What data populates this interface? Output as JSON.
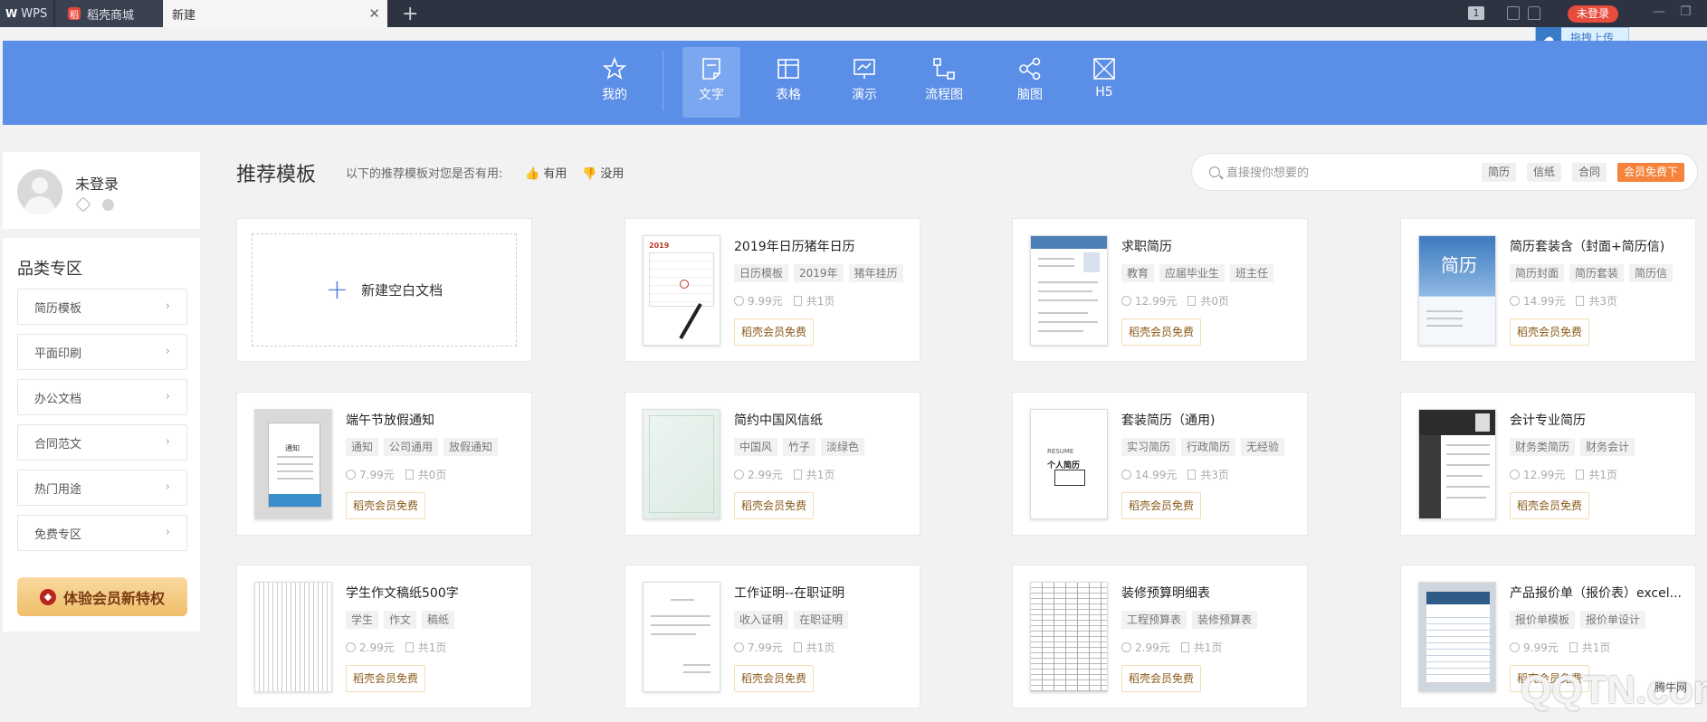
{
  "titlebar": {
    "tabs": [
      {
        "label": "WPS",
        "logo": "W"
      },
      {
        "label": "稻壳商城",
        "logo": "稻"
      },
      {
        "label": "新建"
      }
    ],
    "tab_count": "1",
    "login_label": "未登录",
    "upload_tip": "拖拽上传"
  },
  "categories": [
    {
      "label": "我的",
      "icon": "star-icon"
    },
    {
      "label": "文字",
      "icon": "document-icon"
    },
    {
      "label": "表格",
      "icon": "table-icon"
    },
    {
      "label": "演示",
      "icon": "presentation-icon"
    },
    {
      "label": "流程图",
      "icon": "flowchart-icon"
    },
    {
      "label": "脑图",
      "icon": "mindmap-icon"
    },
    {
      "label": "H5",
      "icon": "h5-icon"
    }
  ],
  "active_category": "文字",
  "user": {
    "name": "未登录"
  },
  "sidebar": {
    "title": "品类专区",
    "items": [
      {
        "label": "简历模板"
      },
      {
        "label": "平面印刷"
      },
      {
        "label": "办公文档"
      },
      {
        "label": "合同范文"
      },
      {
        "label": "热门用途"
      },
      {
        "label": "免费专区"
      }
    ],
    "vip_button": "体验会员新特权"
  },
  "main": {
    "title": "推荐模板",
    "feedback_prompt": "以下的推荐模板对您是否有用:",
    "useful": "有用",
    "useless": "没用"
  },
  "search": {
    "placeholder": "直接搜你想要的",
    "tags": [
      "简历",
      "信纸",
      "合同"
    ],
    "hot_tag": "会员免费下"
  },
  "new_blank_label": "新建空白文档",
  "templates": [
    {
      "title": "2019年日历猪年日历",
      "tags": [
        "日历模板",
        "2019年",
        "猪年挂历"
      ],
      "price": "9.99元",
      "pages": "共1页",
      "free": "稻壳会员免费"
    },
    {
      "title": "求职简历",
      "tags": [
        "教育",
        "应届毕业生",
        "班主任"
      ],
      "price": "12.99元",
      "pages": "共0页",
      "free": "稻壳会员免费"
    },
    {
      "title": "简历套装含（封面+简历信)",
      "tags": [
        "简历封面",
        "简历套装",
        "简历信"
      ],
      "price": "14.99元",
      "pages": "共3页",
      "free": "稻壳会员免费"
    },
    {
      "title": "端午节放假通知",
      "tags": [
        "通知",
        "公司通用",
        "放假通知"
      ],
      "price": "7.99元",
      "pages": "共0页",
      "free": "稻壳会员免费"
    },
    {
      "title": "简约中国风信纸",
      "tags": [
        "中国风",
        "竹子",
        "淡绿色"
      ],
      "price": "2.99元",
      "pages": "共1页",
      "free": "稻壳会员免费"
    },
    {
      "title": "套装简历（通用)",
      "tags": [
        "实习简历",
        "行政简历",
        "无经验"
      ],
      "price": "14.99元",
      "pages": "共3页",
      "free": "稻壳会员免费"
    },
    {
      "title": "会计专业简历",
      "tags": [
        "财务类简历",
        "财务会计"
      ],
      "price": "12.99元",
      "pages": "共1页",
      "free": "稻壳会员免费"
    },
    {
      "title": "学生作文稿纸500字",
      "tags": [
        "学生",
        "作文",
        "稿纸"
      ],
      "price": "2.99元",
      "pages": "共1页",
      "free": "稻壳会员免费"
    },
    {
      "title": "工作证明--在职证明",
      "tags": [
        "收入证明",
        "在职证明"
      ],
      "price": "7.99元",
      "pages": "共1页",
      "free": "稻壳会员免费"
    },
    {
      "title": "装修预算明细表",
      "tags": [
        "工程预算表",
        "装修预算表"
      ],
      "price": "2.99元",
      "pages": "共1页",
      "free": "稻壳会员免费"
    },
    {
      "title": "产品报价单（报价表）excel...",
      "tags": [
        "报价单模板",
        "报价单设计"
      ],
      "price": "9.99元",
      "pages": "共1页",
      "free": "稻壳会员免费"
    }
  ],
  "thumbnail_texts": {
    "calendar_year": "2019",
    "handbill": "通知",
    "resume_en": "RESUME",
    "resume_cn": "个人简历",
    "resume_cover": "简历"
  },
  "watermark": {
    "logo": "QQTN.com",
    "site": "腾牛网"
  },
  "colors": {
    "nav_blue": "#5b8ee6",
    "accent_orange": "#f5833b",
    "login_red": "#e74c3c",
    "vip_gold": "#f0be6a"
  }
}
